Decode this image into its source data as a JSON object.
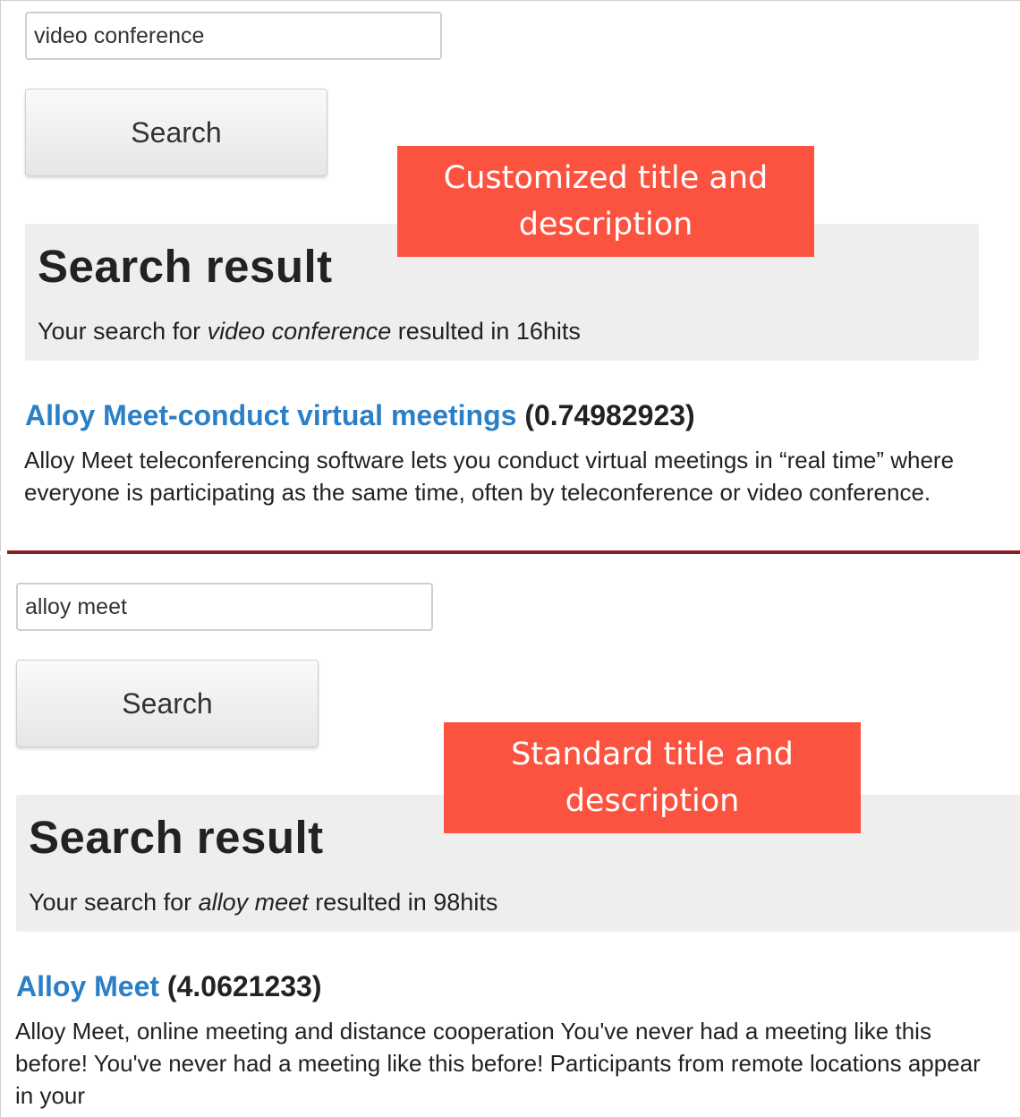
{
  "panels": [
    {
      "search_value": "video conference",
      "search_button": "Search",
      "callout_line1": "Customized title and",
      "callout_line2": "description",
      "result_heading": "Search result",
      "summary_prefix": "Your search for",
      "summary_query": "video conference",
      "summary_suffix": "resulted in 16hits",
      "hit_title": "Alloy Meet-conduct virtual meetings",
      "hit_score": "(0.74982923)",
      "hit_description": "Alloy Meet teleconferencing software lets you conduct virtual meetings in “real time” where everyone is participating as the same time, often by teleconference or video conference."
    },
    {
      "search_value": "alloy meet",
      "search_button": "Search",
      "callout_line1": "Standard title and",
      "callout_line2": "description",
      "result_heading": "Search result",
      "summary_prefix": "Your search for",
      "summary_query": "alloy meet",
      "summary_suffix": "resulted in 98hits",
      "hit_title": "Alloy Meet",
      "hit_score": "(4.0621233)",
      "hit_description": "Alloy Meet, online meeting and distance cooperation You've never had a meeting like this before! You've never had a meeting like this before! Participants from remote locations appear in your"
    }
  ],
  "colors": {
    "callout": "#fc5341",
    "link": "#2a7fc6",
    "divider": "#8b1a24",
    "result_box": "#eeeeee"
  }
}
